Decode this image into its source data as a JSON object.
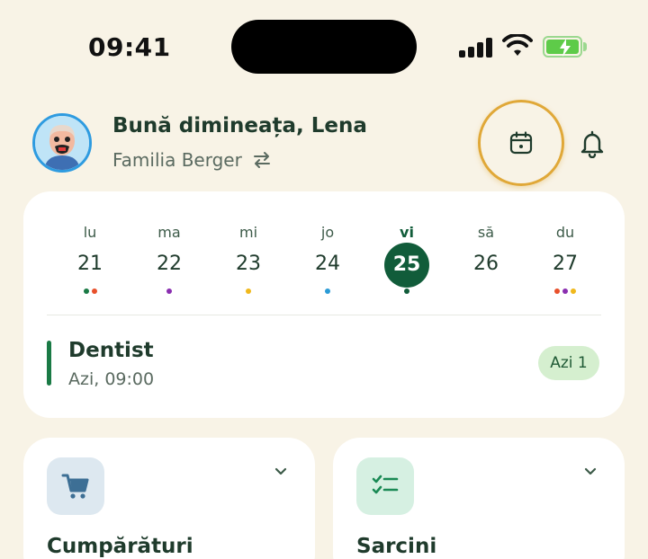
{
  "status_bar": {
    "time": "09:41"
  },
  "header": {
    "greeting": "Bună dimineața, Lena",
    "family": "Familia Berger",
    "calendar_icon": "calendar-icon",
    "bell_icon": "bell-icon",
    "swap_icon": "swap-icon"
  },
  "week": {
    "days": [
      {
        "name": "lu",
        "num": "21",
        "dots": [
          "#1a7a45",
          "#e8502b"
        ]
      },
      {
        "name": "ma",
        "num": "22",
        "dots": [
          "#8a2eb0"
        ]
      },
      {
        "name": "mi",
        "num": "23",
        "dots": [
          "#f0b81c"
        ]
      },
      {
        "name": "jo",
        "num": "24",
        "dots": [
          "#2b9bd6"
        ]
      },
      {
        "name": "vi",
        "num": "25",
        "dots": [
          "#115c3a"
        ],
        "selected": true
      },
      {
        "name": "să",
        "num": "26",
        "dots": []
      },
      {
        "name": "du",
        "num": "27",
        "dots": [
          "#e8502b",
          "#8a2eb0",
          "#f0b81c"
        ]
      }
    ],
    "event": {
      "title": "Dentist",
      "time": "Azi, 09:00",
      "badge": "Azi 1",
      "color": "#1a7a45"
    }
  },
  "cards": {
    "shopping": {
      "title": "Cumpărături",
      "icon": "cart-icon"
    },
    "tasks": {
      "title": "Sarcini",
      "icon": "checklist-icon"
    }
  },
  "colors": {
    "accent": "#115c3a",
    "highlight": "#e0a838",
    "background": "#f8f3e6"
  }
}
